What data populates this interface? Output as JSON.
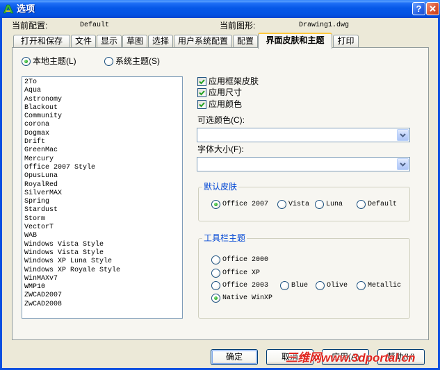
{
  "window": {
    "title": "选项",
    "help_label": "?",
    "close_icon": "close-icon",
    "app_icon": "zwcad-logo-icon"
  },
  "colors": {
    "title_bar": "#0658E8",
    "dialog_background": "#ECE9D8",
    "group_title": "#0046D5",
    "selected_mark": "#21A121",
    "watermark": "#E0251E"
  },
  "header": {
    "profile_label": "当前配置:",
    "profile_value": "Default",
    "drawing_label": "当前图形:",
    "drawing_value": "Drawing1.dwg"
  },
  "tabs": [
    {
      "label": "打开和保存",
      "selected": false
    },
    {
      "label": "文件",
      "selected": false
    },
    {
      "label": "显示",
      "selected": false
    },
    {
      "label": "草图",
      "selected": false
    },
    {
      "label": "选择",
      "selected": false
    },
    {
      "label": "用户系统配置",
      "selected": false
    },
    {
      "label": "配置",
      "selected": false
    },
    {
      "label": "界面皮肤和主题",
      "selected": true
    },
    {
      "label": "打印",
      "selected": false
    }
  ],
  "theme_source": {
    "local": {
      "label": "本地主题(L)",
      "selected": true
    },
    "system": {
      "label": "系统主题(S)",
      "selected": false
    }
  },
  "theme_list": [
    "2To",
    "Aqua",
    "Astronomy",
    "Blackout",
    "Community",
    "corona",
    "Dogmax",
    "Drift",
    "GreenMac",
    "Mercury",
    "Office 2007 Style",
    "OpusLuna",
    "RoyalRed",
    "SilverMAX",
    "Spring",
    "Stardust",
    "Storm",
    "VectorT",
    "WAB",
    "Windows Vista Style",
    "Windows Vista Style",
    "Windows XP Luna Style",
    "Windows XP Royale Style",
    "WinMAXv7",
    "WMP10",
    "ZWCAD2007",
    "ZwCAD2008"
  ],
  "apply_options": [
    {
      "label": "应用框架皮肤",
      "checked": true
    },
    {
      "label": "应用尺寸",
      "checked": true
    },
    {
      "label": "应用颜色",
      "checked": true
    }
  ],
  "optional_color": {
    "label": "可选颜色(C):",
    "value": ""
  },
  "font_size": {
    "label": "字体大小(F):",
    "value": ""
  },
  "default_skin": {
    "title": "默认皮肤",
    "options": [
      {
        "label": "Office 2007",
        "selected": true
      },
      {
        "label": "Vista",
        "selected": false
      },
      {
        "label": "Luna",
        "selected": false
      },
      {
        "label": "Default",
        "selected": false
      }
    ]
  },
  "toolbar_theme": {
    "title": "工具栏主题",
    "options": [
      {
        "label": "Office 2000",
        "selected": false
      },
      {
        "label": "Office XP",
        "selected": false
      },
      {
        "label": "Office 2003",
        "selected": false
      },
      {
        "label": "Blue",
        "selected": false
      },
      {
        "label": "Olive",
        "selected": false
      },
      {
        "label": "Metallic",
        "selected": false
      },
      {
        "label": "Native WinXP",
        "selected": true
      }
    ]
  },
  "buttons": {
    "ok": "确定",
    "cancel": "取消",
    "apply": "应用(A)",
    "help": "帮助(H)"
  },
  "watermark": {
    "site_name": "三维网",
    "url": "www.3dportal.cn"
  }
}
